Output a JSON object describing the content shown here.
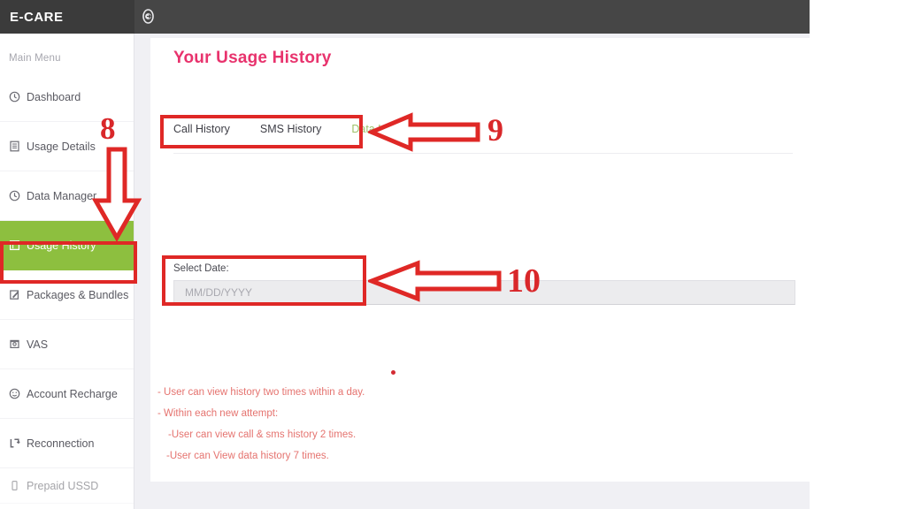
{
  "app": {
    "brand": "E-CARE",
    "toggle_icon": "arrow-circle-right-icon"
  },
  "sidebar": {
    "section_label": "Main Menu",
    "items": [
      {
        "label": "Dashboard",
        "icon": "clock-icon",
        "active": false
      },
      {
        "label": "Usage Details",
        "icon": "list-report-icon",
        "active": false
      },
      {
        "label": "Data Manager",
        "icon": "clock-icon",
        "active": false
      },
      {
        "label": "Usage History",
        "icon": "calendar-icon",
        "active": true
      },
      {
        "label": "Packages & Bundles",
        "icon": "edit-square-icon",
        "active": false
      },
      {
        "label": "VAS",
        "icon": "box-icon",
        "active": false
      },
      {
        "label": "Account Recharge",
        "icon": "smiley-icon",
        "active": false
      },
      {
        "label": "Reconnection",
        "icon": "refresh-arrow-icon",
        "active": false
      },
      {
        "label": "Prepaid USSD",
        "icon": "phone-icon",
        "active": false
      }
    ]
  },
  "page": {
    "title": "Your Usage History"
  },
  "tabs": [
    {
      "label": "Call History",
      "active": false
    },
    {
      "label": "SMS History",
      "active": false
    },
    {
      "label": "Data History",
      "active": true
    }
  ],
  "date_field": {
    "label": "Select Date:",
    "value": "",
    "placeholder": "MM/DD/YYYY"
  },
  "notes": [
    "- User can view history two times within a day.",
    "- Within each new attempt:",
    "-User can view call & sms history 2 times.",
    "-User can View data history 7 times."
  ],
  "annotations": [
    {
      "number": "8",
      "target": "sidebar-item-usage-history"
    },
    {
      "number": "9",
      "target": "tabs-row"
    },
    {
      "number": "10",
      "target": "select-date-field"
    }
  ],
  "colors": {
    "accent_pink": "#e8336d",
    "active_green": "#8dbf3f",
    "annotation_red": "#df2826",
    "note_red": "#e5736f",
    "topbar_dark": "#464646"
  }
}
